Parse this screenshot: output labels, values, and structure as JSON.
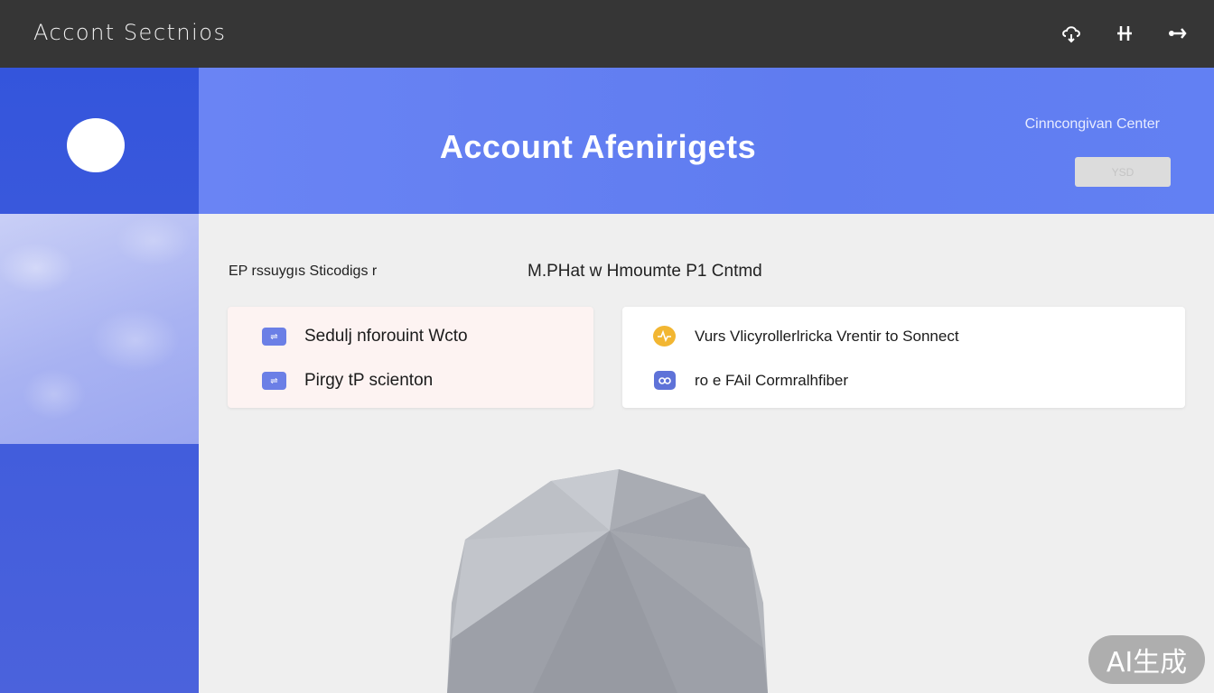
{
  "window": {
    "title": "Accont Sectnios"
  },
  "topbar": {
    "icons": [
      "cloud-settings-icon",
      "tools-icon",
      "share-icon"
    ]
  },
  "sidebar": {
    "avatar": "avatar"
  },
  "hero": {
    "heading": "Account Afenirigets",
    "center_link": "Cinncongivan Center",
    "button_label": "YSD"
  },
  "sections": {
    "left_label": "EP rssuygıs Sticodigs r",
    "right_label": "M.PHat w Hmoumte P1 Cntmd"
  },
  "left_card": {
    "items": [
      {
        "label": "Sedulj nforouint Wcto",
        "icon": "toggle-icon"
      },
      {
        "label": "Pirgy tP scienton",
        "icon": "toggle-icon"
      }
    ]
  },
  "right_card": {
    "items": [
      {
        "label": "Vurs Vlicyrollerlricka Vrentir to Sonnect",
        "icon": "pulse-icon"
      },
      {
        "label": "ro e FAil Cormralhfiber",
        "icon": "link-icon"
      }
    ]
  },
  "watermark": {
    "text": "AI生成"
  },
  "colors": {
    "topbar": "#363636",
    "sidebar": "#3455dc",
    "hero": "#6a84f4",
    "accent_yellow": "#f2b632"
  }
}
